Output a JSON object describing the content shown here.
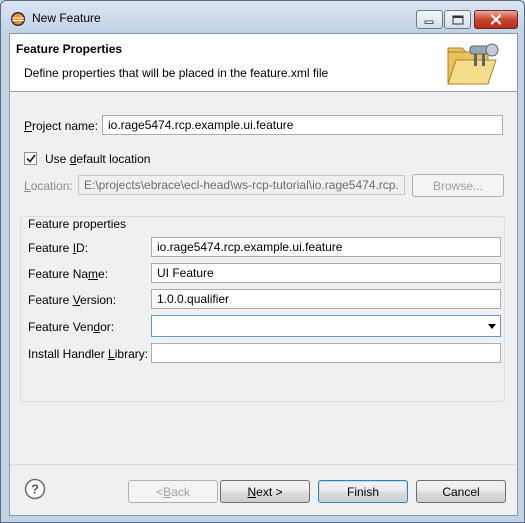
{
  "window": {
    "title": "New Feature"
  },
  "banner": {
    "title": "Feature Properties",
    "description": "Define properties that will be placed in the feature.xml file"
  },
  "project": {
    "label_mn": "P",
    "label_rest": "roject name:",
    "value": "io.rage5474.rcp.example.ui.feature"
  },
  "location": {
    "use_default_pre": "Use ",
    "use_default_mn": "d",
    "use_default_post": "efault location",
    "use_default_checked": true,
    "label_mn": "L",
    "label_rest": "ocation:",
    "value": "E:\\projects\\ebrace\\ecl-head\\ws-rcp-tutorial\\io.rage5474.rcp.",
    "browse_label": "Browse..."
  },
  "feature_properties": {
    "group_title": "Feature properties",
    "id": {
      "label_pre": "Feature ",
      "label_mn": "I",
      "label_post": "D:",
      "value": "io.rage5474.rcp.example.ui.feature"
    },
    "name": {
      "label_pre": "Feature Na",
      "label_mn": "m",
      "label_post": "e:",
      "value": "UI Feature"
    },
    "version": {
      "label_pre": "Feature ",
      "label_mn": "V",
      "label_post": "ersion:",
      "value": "1.0.0.qualifier"
    },
    "vendor": {
      "label_pre": "Feature Ven",
      "label_mn": "d",
      "label_post": "or:",
      "value": ""
    },
    "install_handler": {
      "label_pre": "Install Handler ",
      "label_mn": "L",
      "label_post": "ibrary:",
      "value": ""
    }
  },
  "buttons": {
    "back": {
      "pre": "< ",
      "mn": "B",
      "post": "ack"
    },
    "next": {
      "mn": "N",
      "post": "ext >"
    },
    "finish": "Finish",
    "cancel": "Cancel"
  }
}
